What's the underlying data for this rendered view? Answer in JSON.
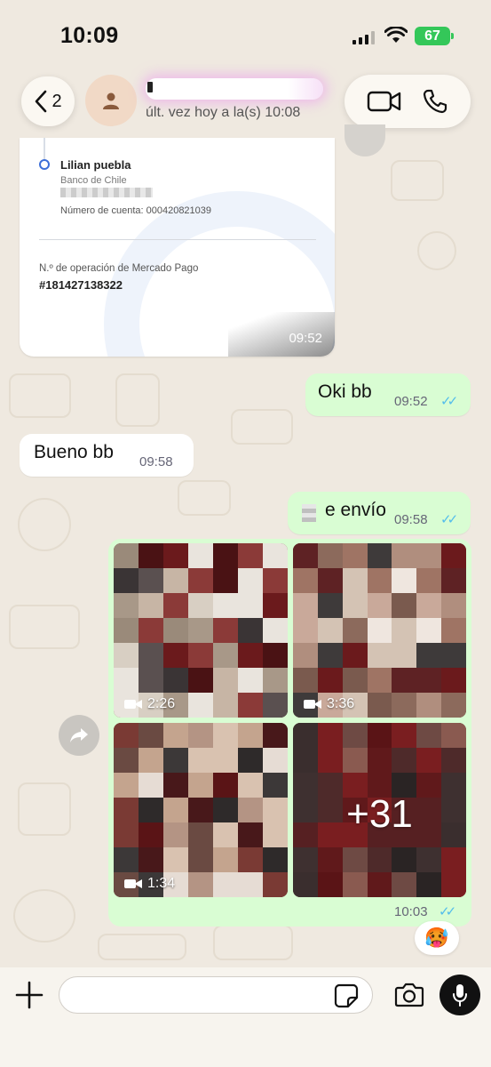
{
  "status_bar": {
    "time": "10:09",
    "battery": "67"
  },
  "header": {
    "back_count": "2",
    "contact_name": "",
    "last_seen": "últ. vez hoy a la(s) 10:08"
  },
  "receipt": {
    "recipient_name": "Lilian puebla",
    "bank": "Banco de Chile",
    "account": "Número de cuenta: 000420821039",
    "operation_label": "N.º de operación de Mercado Pago",
    "operation_number": "#181427138322",
    "time": "09:52"
  },
  "messages": [
    {
      "direction": "outgoing",
      "text": "Oki bb",
      "time": "09:52",
      "read": true
    },
    {
      "direction": "incoming",
      "text": "Bueno bb",
      "time": "09:58"
    },
    {
      "direction": "outgoing",
      "text": "e envío",
      "time": "09:58",
      "read": true
    }
  ],
  "media_album": {
    "videos": [
      {
        "duration": "2:26"
      },
      {
        "duration": "3:36"
      },
      {
        "duration": "1:34"
      }
    ],
    "more_count": "+31",
    "time": "10:03",
    "read": true,
    "reaction": "🥵"
  },
  "composer": {
    "placeholder": ""
  },
  "colors": {
    "outgoing_bubble": "#d9fdd3",
    "incoming_bubble": "#ffffff",
    "read_ticks": "#53bdeb",
    "battery": "#34c759"
  }
}
